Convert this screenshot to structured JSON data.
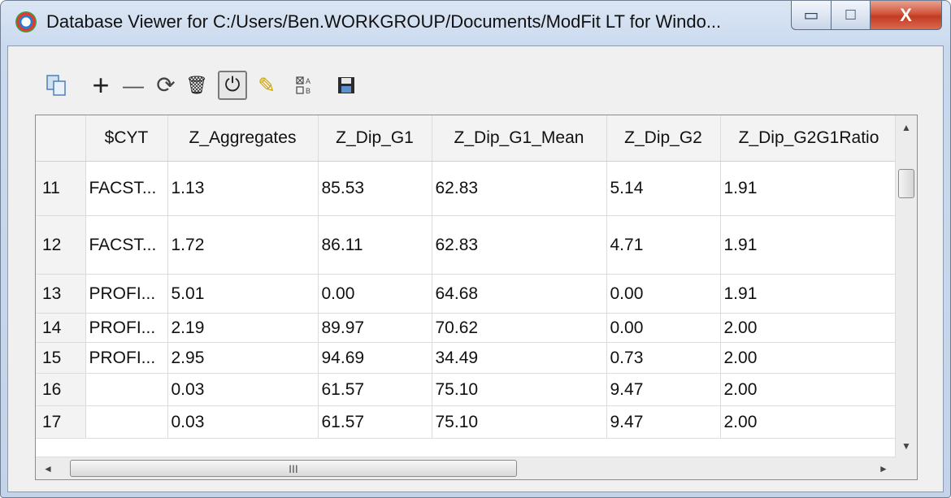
{
  "window": {
    "title": "Database Viewer for C:/Users/Ben.WORKGROUP/Documents/ModFit LT for Windo...",
    "minimize_glyph": "▭",
    "maximize_glyph": "□",
    "close_glyph": "X"
  },
  "toolbar": {
    "copy_icon": "copy-icon",
    "add_label": "+",
    "remove_label": "—",
    "refresh_label": "⟳",
    "delete_label": "🗑",
    "power_label": "⏻",
    "edit_label": "✎",
    "columns_label": "⊠A\n□B",
    "save_label": "💾"
  },
  "grid": {
    "columns": [
      "",
      "$CYT",
      "Z_Aggregates",
      "Z_Dip_G1",
      "Z_Dip_G1_Mean",
      "Z_Dip_G2",
      "Z_Dip_G2G1Ratio"
    ],
    "rows": [
      {
        "id": "11",
        "cells": [
          "FACST...",
          "1.13",
          "85.53",
          "62.83",
          "5.14",
          "1.91"
        ]
      },
      {
        "id": "12",
        "cells": [
          "FACST...",
          "1.72",
          "86.11",
          "62.83",
          "4.71",
          "1.91"
        ]
      },
      {
        "id": "13",
        "cells": [
          "PROFI...",
          "5.01",
          "0.00",
          "64.68",
          "0.00",
          "1.91"
        ]
      },
      {
        "id": "14",
        "cells": [
          "PROFI...",
          "2.19",
          "89.97",
          "70.62",
          "0.00",
          "2.00"
        ]
      },
      {
        "id": "15",
        "cells": [
          "PROFI...",
          "2.95",
          "94.69",
          "34.49",
          "0.73",
          "2.00"
        ]
      },
      {
        "id": "16",
        "cells": [
          "",
          "0.03",
          "61.57",
          "75.10",
          "9.47",
          "2.00"
        ]
      },
      {
        "id": "17",
        "cells": [
          "",
          "0.03",
          "61.57",
          "75.10",
          "9.47",
          "2.00"
        ]
      }
    ]
  },
  "scrollbar": {
    "up_arrow": "▲",
    "down_arrow": "▼",
    "left_arrow": "◄",
    "right_arrow": "►",
    "h_thumb_grip": "III"
  },
  "colors": {
    "title_bg": "#c9d9ee",
    "close_button": "#c23b22",
    "client_bg": "#f0f0f0",
    "header_bg": "#f3f3f3",
    "gridline": "#dcdcdc"
  }
}
